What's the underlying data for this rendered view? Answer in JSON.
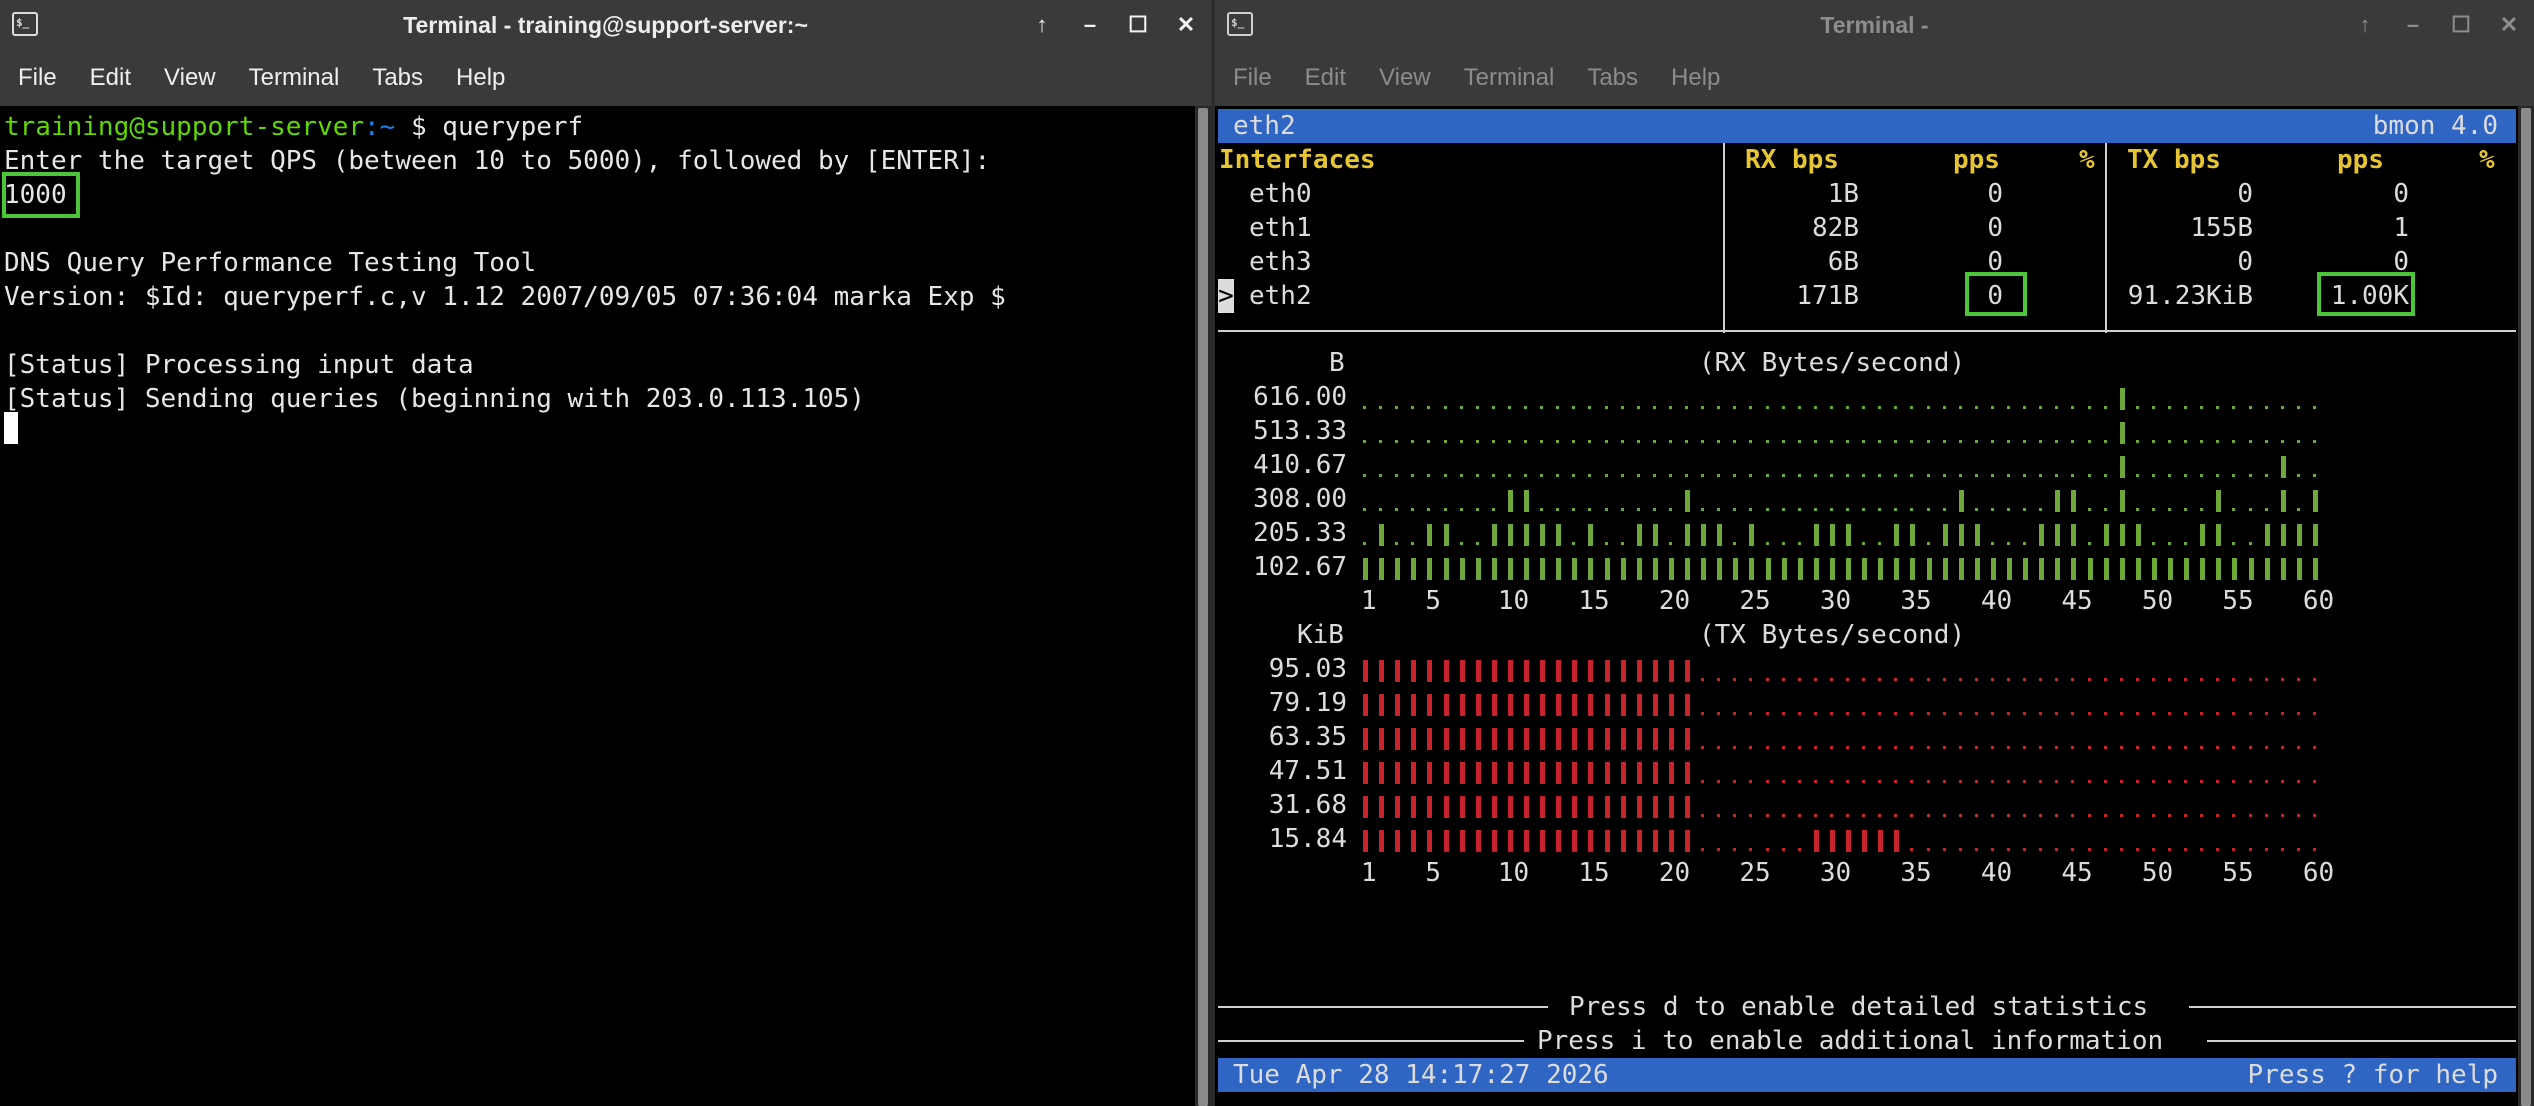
{
  "left_window": {
    "title": "Terminal - training@support-server:~",
    "menu": [
      "File",
      "Edit",
      "View",
      "Terminal",
      "Tabs",
      "Help"
    ],
    "prompt_user": "training@support-server",
    "prompt_path": ":~",
    "prompt_rest": " $ queryperf",
    "lines": [
      "Enter the target QPS (between 10 to 5000), followed by [ENTER]:",
      "1000",
      "",
      "DNS Query Performance Testing Tool",
      "Version: $Id: queryperf.c,v 1.12 2007/09/05 07:36:04 marka Exp $",
      "",
      "[Status] Processing input data",
      "[Status] Sending queries (beginning with 203.0.113.105)"
    ]
  },
  "right_window": {
    "title": "Terminal -",
    "menu": [
      "File",
      "Edit",
      "View",
      "Terminal",
      "Tabs",
      "Help"
    ],
    "bmon": {
      "header_left": "eth2",
      "header_right": "bmon 4.0",
      "col_interfaces": "Interfaces",
      "col_rx_bps": "RX bps",
      "col_rx_pps": "pps",
      "col_rx_pct": "%",
      "col_tx_bps": "TX bps",
      "col_tx_pps": "pps",
      "col_tx_pct": "%",
      "rows": [
        {
          "name": "eth0",
          "rx_bps": "1B",
          "rx_pps": "0",
          "tx_bps": "0",
          "tx_pps": "0"
        },
        {
          "name": "eth1",
          "rx_bps": "82B",
          "rx_pps": "0",
          "tx_bps": "155B",
          "tx_pps": "1"
        },
        {
          "name": "eth3",
          "rx_bps": "6B",
          "rx_pps": "0",
          "tx_bps": "0",
          "tx_pps": "0"
        },
        {
          "name": "eth2",
          "rx_bps": "171B",
          "rx_pps": "0",
          "tx_bps": "91.23KiB",
          "tx_pps": "1.00K"
        }
      ],
      "selected_marker": ">",
      "rx_graph": {
        "unit": "B",
        "title": "(RX Bytes/second)",
        "y_labels": [
          "616.00",
          "513.33",
          "410.67",
          "308.00",
          "205.33",
          "102.67"
        ],
        "x_labels": [
          "1",
          "5",
          "10",
          "15",
          "20",
          "25",
          "30",
          "35",
          "40",
          "45",
          "50",
          "55",
          "60"
        ],
        "color": "#6fa83a"
      },
      "tx_graph": {
        "unit": "KiB",
        "title": "(TX Bytes/second)",
        "y_labels": [
          "95.03",
          "79.19",
          "63.35",
          "47.51",
          "31.68",
          "15.84"
        ],
        "x_labels": [
          "1",
          "5",
          "10",
          "15",
          "20",
          "25",
          "30",
          "35",
          "40",
          "45",
          "50",
          "55",
          "60"
        ],
        "color": "#c8232b"
      },
      "footer_d": "Press d to enable detailed statistics",
      "footer_i": "Press i to enable additional information",
      "status_left": "Tue Apr 28 14:17:27 2026",
      "status_right": "Press ? for help"
    }
  }
}
